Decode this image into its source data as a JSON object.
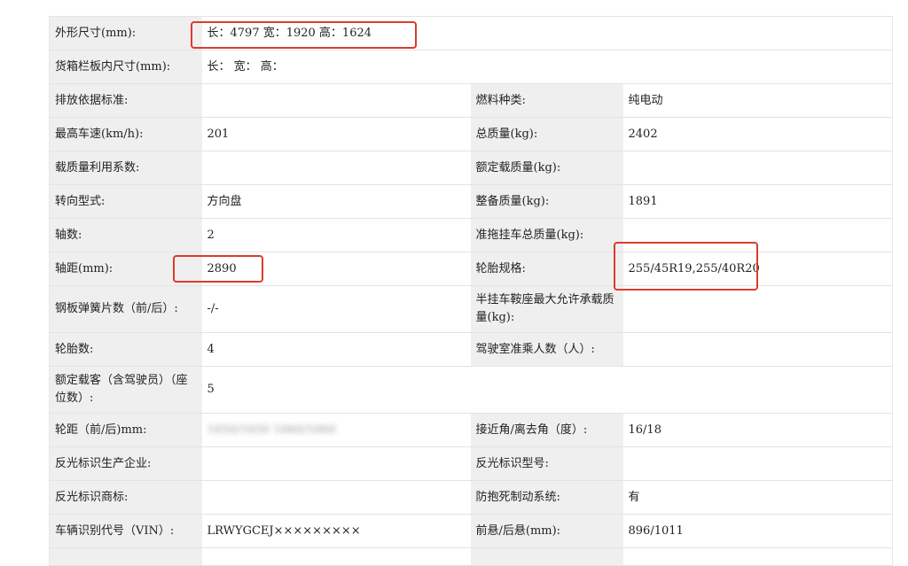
{
  "rows": [
    {
      "cells": [
        {
          "label": "外形尺寸(mm):",
          "value": "长：4797 宽：1920 高：1624",
          "span": 3
        }
      ]
    },
    {
      "cells": [
        {
          "label": "货箱栏板内尺寸(mm):",
          "value": "长：  宽：  高：",
          "span": 3
        }
      ]
    },
    {
      "cells": [
        {
          "label": "排放依据标准:",
          "value": ""
        },
        {
          "label": "燃料种类:",
          "value": "纯电动"
        }
      ]
    },
    {
      "cells": [
        {
          "label": "最高车速(km/h):",
          "value": "201"
        },
        {
          "label": "总质量(kg):",
          "value": "2402"
        }
      ]
    },
    {
      "cells": [
        {
          "label": "载质量利用系数:",
          "value": ""
        },
        {
          "label": "额定载质量(kg):",
          "value": ""
        }
      ]
    },
    {
      "cells": [
        {
          "label": "转向型式:",
          "value": "方向盘"
        },
        {
          "label": "整备质量(kg):",
          "value": "1891"
        }
      ]
    },
    {
      "cells": [
        {
          "label": "轴数:",
          "value": "2"
        },
        {
          "label": "准拖挂车总质量(kg):",
          "value": ""
        }
      ]
    },
    {
      "cells": [
        {
          "label": "轴距(mm):",
          "value": "2890"
        },
        {
          "label": "轮胎规格:",
          "value": "255/45R19,255/40R20"
        }
      ]
    },
    {
      "cells": [
        {
          "label": "钢板弹簧片数（前/后）:",
          "value": "-/-"
        },
        {
          "label": "半挂车鞍座最大允许承载质量(kg):",
          "value": ""
        }
      ]
    },
    {
      "cells": [
        {
          "label": "轮胎数:",
          "value": "4"
        },
        {
          "label": "驾驶室准乘人数（人）:",
          "value": ""
        }
      ]
    },
    {
      "cells": [
        {
          "label": "额定载客（含驾驶员）（座位数）:",
          "value": "5",
          "span": 3
        }
      ]
    },
    {
      "cells": [
        {
          "label": "轮距（前/后)mm:",
          "value": "1650/1650 1660/1660",
          "blurred": true
        },
        {
          "label": "接近角/离去角（度）:",
          "value": "16/18"
        }
      ]
    },
    {
      "cells": [
        {
          "label": "反光标识生产企业:",
          "value": ""
        },
        {
          "label": "反光标识型号:",
          "value": ""
        }
      ]
    },
    {
      "cells": [
        {
          "label": "反光标识商标:",
          "value": ""
        },
        {
          "label": "防抱死制动系统:",
          "value": "有"
        }
      ]
    },
    {
      "cells": [
        {
          "label": "车辆识别代号（VIN）:",
          "value": "LRWYGCEJ×××××××××"
        },
        {
          "label": "前悬/后悬(mm):",
          "value": "896/1011"
        }
      ]
    },
    {
      "cells": [
        {
          "label": "",
          "value": ""
        },
        {
          "label": "",
          "value": ""
        }
      ]
    }
  ]
}
